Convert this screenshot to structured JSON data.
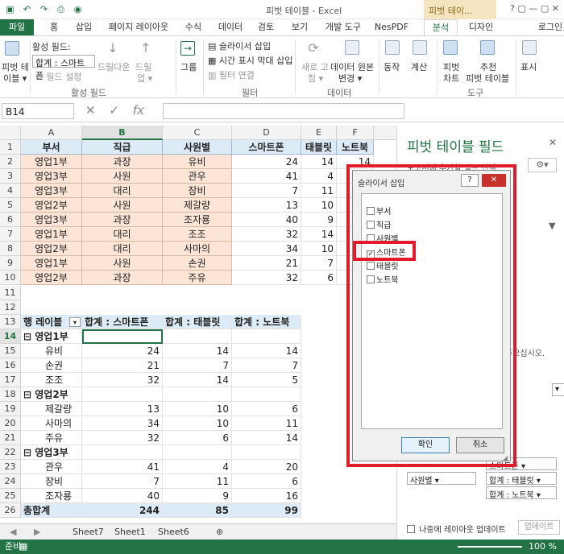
{
  "window": {
    "title": "피벗 테이블 - Excel",
    "context_tab": "피벗 테이...",
    "user": "로그인"
  },
  "tabs": [
    "파일",
    "홈",
    "삽입",
    "페이지 레이아웃",
    "수식",
    "데이터",
    "검토",
    "보기",
    "개발 도구",
    "NesPDF",
    "분석",
    "디자인"
  ],
  "ribbon": {
    "pivot_table": "피벗 테이블",
    "pivot_table_l1": "피벗 테",
    "pivot_table_l2": "이블 ▾",
    "active_field_label": "활성 필드:",
    "active_field_value": "합계 : 스마트폰",
    "field_settings": "필드 설정",
    "drill_down": "드릴다운",
    "drill_up_l1": "드릴",
    "drill_up_l2": "업 ▾",
    "group_active_field": "활성 필드",
    "group_btn": "그룹",
    "insert_slicer": "슬라이서 삽입",
    "insert_timeline": "시간 표시 막대 삽입",
    "filter_connections": "필터 연결",
    "group_filter": "필터",
    "refresh_l1": "새로 고",
    "refresh_l2": "침 ▾",
    "change_source_l1": "데이터 원본",
    "change_source_l2": "변경 ▾",
    "group_data": "데이터",
    "actions": "동작",
    "calculations": "계산",
    "pivot_chart_l1": "피벗",
    "pivot_chart_l2": "차트",
    "recommended_l1": "추천",
    "recommended_l2": "피벗 테이블",
    "group_tools": "도구",
    "show": "표시"
  },
  "formula_bar": {
    "name_box": "B14",
    "fx": "fx"
  },
  "columns": [
    "A",
    "B",
    "C",
    "D",
    "E",
    "F"
  ],
  "rows": [
    "1",
    "2",
    "3",
    "4",
    "5",
    "6",
    "7",
    "8",
    "9",
    "10",
    "11",
    "12",
    "13",
    "14",
    "15",
    "16",
    "17",
    "18",
    "19",
    "20",
    "21",
    "22",
    "23",
    "24",
    "25",
    "26"
  ],
  "source_headers": [
    "부서",
    "직급",
    "사원별",
    "스마트폰",
    "태블릿",
    "노트북"
  ],
  "source_rows": [
    [
      "영업1부",
      "과장",
      "유비",
      "24",
      "14",
      "14"
    ],
    [
      "영업3부",
      "사원",
      "관우",
      "41",
      "4",
      ""
    ],
    [
      "영업3부",
      "대리",
      "장비",
      "7",
      "11",
      ""
    ],
    [
      "영업2부",
      "사원",
      "제갈량",
      "13",
      "10",
      ""
    ],
    [
      "영업3부",
      "과장",
      "조자룡",
      "40",
      "9",
      ""
    ],
    [
      "영업1부",
      "대리",
      "조조",
      "32",
      "14",
      ""
    ],
    [
      "영업2부",
      "대리",
      "사마의",
      "34",
      "10",
      ""
    ],
    [
      "영업1부",
      "사원",
      "손권",
      "21",
      "7",
      ""
    ],
    [
      "영업2부",
      "과장",
      "주유",
      "32",
      "6",
      ""
    ]
  ],
  "pivot": {
    "headers": [
      "행 레이블",
      "합계 : 스마트폰",
      "합계 : 태블릿",
      "합계 : 노트북"
    ],
    "rows": [
      {
        "label": "⊟ 영업1부",
        "group": true,
        "v": [
          "",
          "",
          ""
        ]
      },
      {
        "label": "유비",
        "group": false,
        "v": [
          "24",
          "14",
          "14"
        ]
      },
      {
        "label": "손권",
        "group": false,
        "v": [
          "21",
          "7",
          "7"
        ]
      },
      {
        "label": "조조",
        "group": false,
        "v": [
          "32",
          "14",
          "5"
        ]
      },
      {
        "label": "⊟ 영업2부",
        "group": true,
        "v": [
          "",
          "",
          ""
        ]
      },
      {
        "label": "제갈량",
        "group": false,
        "v": [
          "13",
          "10",
          "6"
        ]
      },
      {
        "label": "사마의",
        "group": false,
        "v": [
          "34",
          "10",
          "11"
        ]
      },
      {
        "label": "주유",
        "group": false,
        "v": [
          "32",
          "6",
          "14"
        ]
      },
      {
        "label": "⊟ 영업3부",
        "group": true,
        "v": [
          "",
          "",
          ""
        ]
      },
      {
        "label": "관우",
        "group": false,
        "v": [
          "41",
          "4",
          "20"
        ]
      },
      {
        "label": "장비",
        "group": false,
        "v": [
          "7",
          "11",
          "6"
        ]
      },
      {
        "label": "조자룡",
        "group": false,
        "v": [
          "40",
          "9",
          "16"
        ]
      }
    ],
    "total_label": "총합계",
    "totals": [
      "244",
      "85",
      "99"
    ]
  },
  "sheet_tabs": [
    "Sheet7",
    "Sheet1",
    "Sheet6"
  ],
  "status": {
    "ready": "준비",
    "zoom": "100 %"
  },
  "pane": {
    "title": "피벗 테이블 필드",
    "subtitle": "보고서에 추가할 필드 선택:",
    "hint": "주오십시오.",
    "dd_smartphone": "스마트폰 ▾",
    "dd_employee": "사원별 ▾",
    "dd_tablet": "합계 : 태블릿 ▾",
    "dd_notebook": "합계 : 노트북 ▾",
    "defer_update": "나중에 레이아웃 업데이트",
    "update_btn": "업데이트"
  },
  "dialog": {
    "title": "슬라이서 삽입",
    "help": "?",
    "close": "✕",
    "items": [
      {
        "label": "부서",
        "checked": false
      },
      {
        "label": "직급",
        "checked": false
      },
      {
        "label": "사원별",
        "checked": false
      },
      {
        "label": "스마트폰",
        "checked": true
      },
      {
        "label": "태블릿",
        "checked": false
      },
      {
        "label": "노트북",
        "checked": false
      }
    ],
    "ok": "확인",
    "cancel": "취소"
  }
}
